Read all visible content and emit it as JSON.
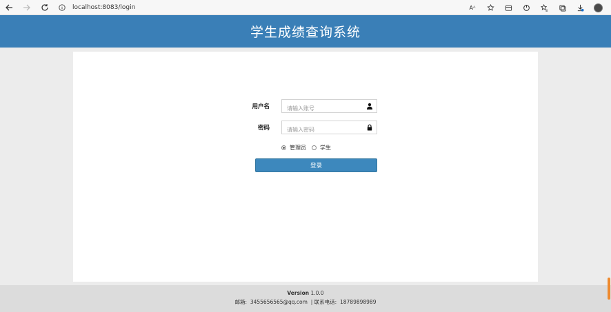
{
  "browser": {
    "url": "localhost:8083/login",
    "read_aloud_label": "Aᴬ"
  },
  "header": {
    "title": "学生成绩查询系统"
  },
  "login_form": {
    "username_label": "用户名",
    "username_placeholder": "请输入账号",
    "username_value": "",
    "password_label": "密码",
    "password_placeholder": "请输入密码",
    "password_value": "",
    "roles": [
      {
        "label": "管理员",
        "checked": true
      },
      {
        "label": "学生",
        "checked": false
      }
    ],
    "submit_label": "登录"
  },
  "footer": {
    "version_label": "Version",
    "version_number": "1.0.0",
    "email_label": "邮箱:",
    "email": "3455656565@qq.com",
    "separator": "|",
    "phone_label": "联系电话:",
    "phone": "18789898989"
  },
  "colors": {
    "header_bg": "#3a7fb7",
    "button_bg": "#3d88bd",
    "page_bg": "#ececec",
    "footer_bg": "#dcdcdc",
    "scroll_accent": "#ee8a2e"
  },
  "icons": {
    "back": "arrow-left-icon",
    "forward": "arrow-right-icon",
    "refresh": "refresh-icon",
    "site_info": "info-icon",
    "username": "user-icon",
    "password": "lock-icon"
  }
}
